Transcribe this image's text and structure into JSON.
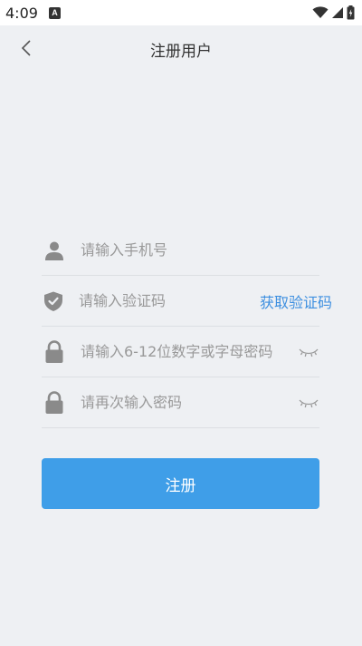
{
  "status_bar": {
    "time": "4:09",
    "notification_letter": "A"
  },
  "header": {
    "title": "注册用户"
  },
  "form": {
    "phone": {
      "placeholder": "请输入手机号",
      "value": ""
    },
    "code": {
      "placeholder": "请输入验证码",
      "value": "",
      "get_code_label": "获取验证码"
    },
    "password": {
      "placeholder": "请输入6-12位数字或字母密码",
      "value": ""
    },
    "confirm_password": {
      "placeholder": "请再次输入密码",
      "value": ""
    }
  },
  "submit": {
    "label": "注册"
  },
  "colors": {
    "background": "#eef0f3",
    "accent": "#3f9ee8",
    "link": "#3d8fe0",
    "icon": "#8a8a8a",
    "placeholder": "#999999"
  },
  "icons": {
    "back": "chevron-left-icon",
    "phone": "user-icon",
    "code": "shield-check-icon",
    "password": "lock-icon",
    "confirm_password": "lock-icon",
    "eye": "eye-closed-icon"
  }
}
